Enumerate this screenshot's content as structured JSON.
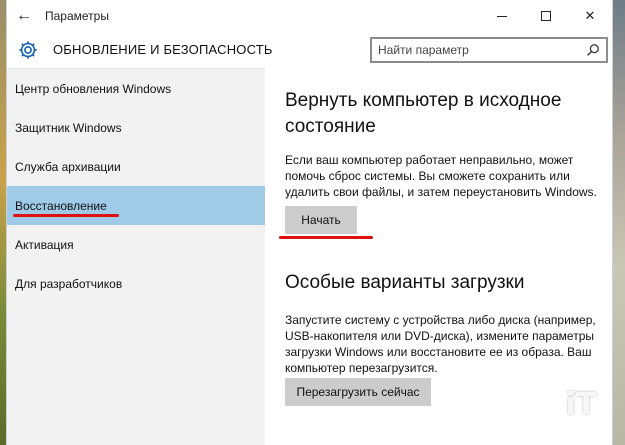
{
  "window": {
    "title": "Параметры"
  },
  "header": {
    "title": "ОБНОВЛЕНИЕ И БЕЗОПАСНОСТЬ",
    "search_placeholder": "Найти параметр"
  },
  "sidebar": {
    "items": [
      {
        "label": "Центр обновления Windows"
      },
      {
        "label": "Защитник Windows"
      },
      {
        "label": "Служба архивации"
      },
      {
        "label": "Восстановление",
        "active": true
      },
      {
        "label": "Активация"
      },
      {
        "label": "Для разработчиков"
      }
    ]
  },
  "main": {
    "reset": {
      "heading": "Вернуть компьютер в исходное состояние",
      "description": "Если ваш компьютер работает неправильно, может помочь сброс системы. Вы сможете сохранить или удалить свои файлы, и затем переустановить Windows.",
      "button": "Начать"
    },
    "advanced": {
      "heading": "Особые варианты загрузки",
      "description": "Запустите систему с устройства либо диска (например, USB-накопителя или DVD-диска), измените параметры загрузки Windows или восстановите ее из образа. Ваш компьютер перезагрузится.",
      "button": "Перезагрузить сейчас"
    }
  },
  "colors": {
    "active_item": "#9fcbe8",
    "annotation_red": "#e01010",
    "button_bg": "#cccccc",
    "sidebar_bg": "#f2f2f2"
  }
}
